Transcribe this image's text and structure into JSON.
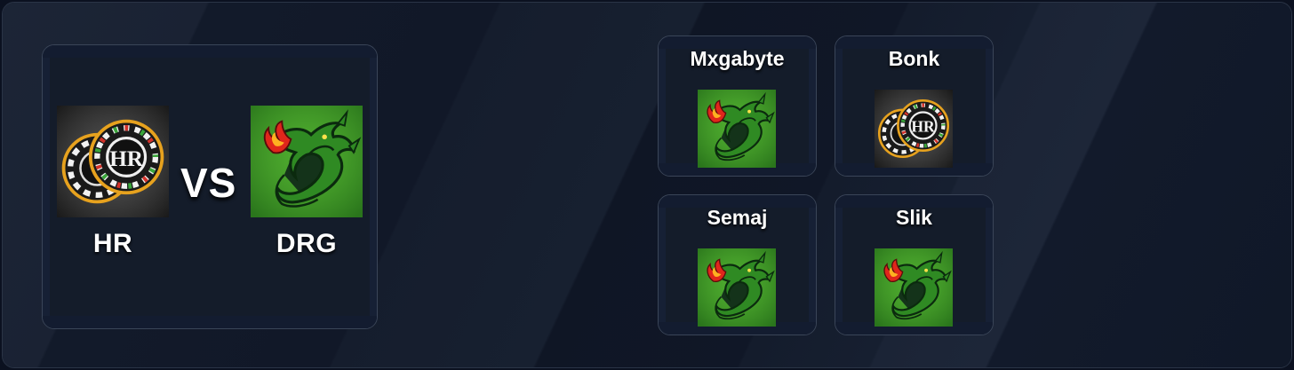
{
  "match": {
    "home": {
      "name": "HR",
      "logo": "casino-chips-logo-icon"
    },
    "away": {
      "name": "DRG",
      "logo": "green-dragon-logo-icon"
    },
    "vs_label": "VS"
  },
  "players": [
    {
      "name": "Mxgabyte",
      "logo": "green-dragon-logo-icon"
    },
    {
      "name": "Bonk",
      "logo": "casino-chips-logo-icon"
    },
    {
      "name": "Semaj",
      "logo": "green-dragon-logo-icon"
    },
    {
      "name": "Slik",
      "logo": "green-dragon-logo-icon"
    }
  ],
  "colors": {
    "background": "#0f1626",
    "card_border": "#3a4558",
    "dragon_green": "#3ea62a",
    "chip_gold": "#e7a21e"
  }
}
